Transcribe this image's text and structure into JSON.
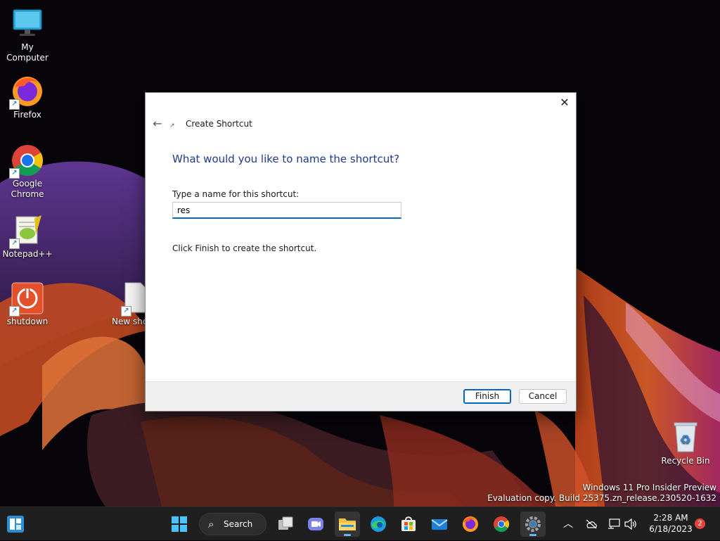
{
  "desktop": {
    "icons": [
      {
        "label": "My Computer"
      },
      {
        "label": "Firefox"
      },
      {
        "label": "Google Chrome"
      },
      {
        "label": "Notepad++"
      },
      {
        "label": "shutdown"
      },
      {
        "label": "New sho"
      },
      {
        "label": "Recycle Bin"
      }
    ]
  },
  "dialog": {
    "title": "Create Shortcut",
    "heading": "What would you like to name the shortcut?",
    "field_label": "Type a name for this shortcut:",
    "field_value": "res",
    "info": "Click Finish to create the shortcut.",
    "finish_label": "Finish",
    "cancel_label": "Cancel",
    "close_glyph": "✕",
    "back_glyph": "←"
  },
  "watermark": {
    "line1": "Windows 11 Pro Insider Preview",
    "line2": "Evaluation copy. Build 25375.zn_release.230520-1632"
  },
  "taskbar": {
    "search_label": "Search",
    "apps": [
      "widgets-icon",
      "start-icon",
      "task-view-icon",
      "teams-chat-icon",
      "file-explorer-icon",
      "edge-icon",
      "store-icon",
      "mail-icon",
      "firefox-icon",
      "chrome-icon",
      "settings-icon"
    ],
    "time": "2:28 AM",
    "date": "6/18/2023",
    "notification_count": "2"
  },
  "colors": {
    "accent": "#0067c0",
    "heading": "#1e3a8a",
    "taskbar": "#1f1f1f"
  }
}
